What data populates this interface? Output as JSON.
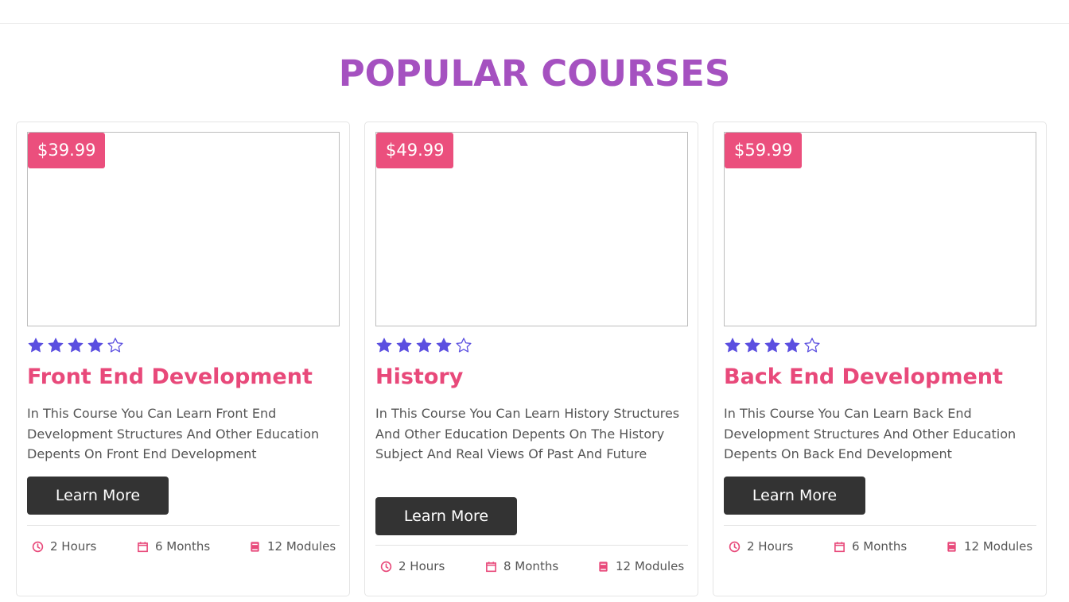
{
  "section": {
    "title": "POPULAR COURSES"
  },
  "colors": {
    "title": "#a551c0",
    "accent": "#e8497a",
    "price_bg": "#eb4f7d",
    "star": "#5b4fe0",
    "button_bg": "#333333"
  },
  "icons": {
    "duration": "clock-icon",
    "period": "calendar-icon",
    "modules": "book-icon",
    "rating_full": "star-filled-icon",
    "rating_empty": "star-outline-icon"
  },
  "courses": [
    {
      "price": "$39.99",
      "rating": 4,
      "rating_max": 5,
      "title": "Front End Development",
      "description": "In This Course You Can Learn Front End Development Structures And Other Education Depents On Front End Development",
      "button_label": "Learn More",
      "meta": {
        "duration": "2 Hours",
        "period": "6 Months",
        "modules": "12 Modules"
      }
    },
    {
      "price": "$49.99",
      "rating": 4,
      "rating_max": 5,
      "title": "History",
      "description": "In This Course You Can Learn History Structures And Other Education Depents On The History Subject And Real Views Of Past And Future",
      "button_label": "Learn More",
      "meta": {
        "duration": "2 Hours",
        "period": "8 Months",
        "modules": "12 Modules"
      }
    },
    {
      "price": "$59.99",
      "rating": 4,
      "rating_max": 5,
      "title": "Back End Development",
      "description": "In This Course You Can Learn Back End Development Structures And Other Education Depents On Back End Development",
      "button_label": "Learn More",
      "meta": {
        "duration": "2 Hours",
        "period": "6 Months",
        "modules": "12 Modules"
      }
    }
  ]
}
